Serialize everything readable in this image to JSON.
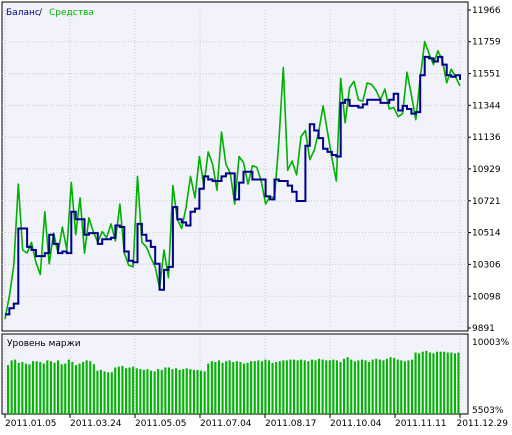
{
  "colors": {
    "background": "#f2f2fa",
    "grid": "#c8c8d2",
    "balance": "#00008b",
    "equity": "#00b000",
    "margin_bars": "#00b400",
    "frame": "#000000"
  },
  "legend": {
    "balance": "Баланс",
    "separator": " / ",
    "equity": "Средства"
  },
  "chart_data": [
    {
      "type": "line",
      "title": "",
      "ylim": [
        9891,
        11966
      ],
      "y_ticks": [
        "11966",
        "11759",
        "11551",
        "11344",
        "11136",
        "10929",
        "10721",
        "10514",
        "10306",
        "10098",
        "9891"
      ],
      "x_ticks": [
        "2011.01.05",
        "2011.03.24",
        "2011.05.05",
        "2011.07.04",
        "2011.08.17",
        "2011.10.04",
        "2011.11.11",
        "2011.12.29"
      ],
      "series": [
        {
          "name": "Баланс",
          "values": [
            9980,
            10020,
            10050,
            10540,
            10540,
            10420,
            10400,
            10360,
            10360,
            10380,
            10500,
            10440,
            10380,
            10390,
            10380,
            10650,
            10600,
            10600,
            10500,
            10510,
            10510,
            10440,
            10470,
            10470,
            10480,
            10560,
            10550,
            10390,
            10330,
            10320,
            10570,
            10500,
            10460,
            10420,
            10310,
            10140,
            10270,
            10290,
            10680,
            10600,
            10580,
            10560,
            10650,
            10670,
            10800,
            10880,
            10860,
            10850,
            10850,
            10880,
            10900,
            10900,
            10730,
            10840,
            10910,
            10910,
            10860,
            10860,
            10860,
            10750,
            10730,
            10860,
            10850,
            10850,
            10820,
            10780,
            10720,
            10720,
            11080,
            11220,
            11180,
            11130,
            11060,
            11040,
            11020,
            11010,
            11360,
            11380,
            11340,
            11340,
            11330,
            11350,
            11380,
            11380,
            11380,
            11360,
            11360,
            11380,
            11420,
            11310,
            11340,
            11320,
            11290,
            11300,
            11540,
            11660,
            11650,
            11630,
            11660,
            11610,
            11540,
            11530,
            11540,
            11510
          ]
        },
        {
          "name": "Средства",
          "values": [
            9950,
            10100,
            10300,
            10830,
            10400,
            10380,
            10450,
            10320,
            10240,
            10650,
            10310,
            10510,
            10380,
            10550,
            10400,
            10840,
            10500,
            10740,
            10380,
            10610,
            10520,
            10450,
            10520,
            10480,
            10570,
            10460,
            10700,
            10380,
            10300,
            10290,
            10880,
            10450,
            10420,
            10350,
            10290,
            10150,
            10400,
            10220,
            10820,
            10600,
            10540,
            10680,
            10880,
            10740,
            11010,
            10820,
            11040,
            10960,
            10790,
            11170,
            10960,
            10900,
            10700,
            11010,
            10970,
            10830,
            10950,
            10940,
            10850,
            10700,
            10750,
            10740,
            11110,
            11590,
            10920,
            10980,
            10890,
            11140,
            11180,
            10990,
            11050,
            11170,
            11340,
            11170,
            11000,
            10850,
            11520,
            11230,
            11460,
            11500,
            11380,
            11370,
            11490,
            11480,
            11440,
            11380,
            11450,
            11320,
            11330,
            11270,
            11290,
            11560,
            11410,
            11250,
            11520,
            11760,
            11680,
            11610,
            11700,
            11640,
            11490,
            11580,
            11530,
            11470
          ]
        }
      ],
      "grid": true,
      "legend": "top-left"
    },
    {
      "type": "bar",
      "title": "Уровень маржи",
      "ylim": [
        "5503%",
        "10003%"
      ],
      "ylim_values": [
        5503,
        10003
      ],
      "x_ticks": [
        "2011.01.05",
        "2011.03.24",
        "2011.05.05",
        "2011.07.04",
        "2011.08.17",
        "2011.10.04",
        "2011.11.11",
        "2011.12.29"
      ],
      "values": [
        8600,
        8900,
        8950,
        8750,
        8800,
        8700,
        8650,
        8850,
        8850,
        8800,
        8700,
        8900,
        8850,
        8750,
        8900,
        8650,
        8700,
        8950,
        8800,
        8600,
        8700,
        8800,
        8900,
        8850,
        8650,
        8250,
        8300,
        8200,
        8150,
        8150,
        8450,
        8500,
        8550,
        8400,
        8450,
        8500,
        8400,
        8350,
        8300,
        8350,
        8250,
        8200,
        8350,
        8300,
        8450,
        8450,
        8350,
        8400,
        8300,
        8350,
        8400,
        8350,
        8300,
        8300,
        8250,
        8200,
        8700,
        8850,
        8800,
        8900,
        8750,
        8850,
        8900,
        8800,
        8850,
        8800,
        8700,
        8750,
        8850,
        8850,
        8900,
        8850,
        8950,
        8900,
        8750,
        8800,
        8850,
        8900,
        8900,
        8950,
        8950,
        8900,
        8950,
        8900,
        8850,
        8950,
        8900,
        9000,
        8950,
        8900,
        8900,
        8950,
        8900,
        8800,
        9000,
        9100,
        8950,
        8850,
        8900,
        8950,
        8900,
        8800,
        8950,
        9000,
        8950,
        8900,
        9000,
        9100,
        9050,
        8950,
        8900,
        8850,
        8900,
        8950,
        9400,
        9350,
        9450,
        9500,
        9400,
        9350,
        9450,
        9450,
        9450,
        9400,
        9400,
        9350,
        9400
      ]
    }
  ]
}
